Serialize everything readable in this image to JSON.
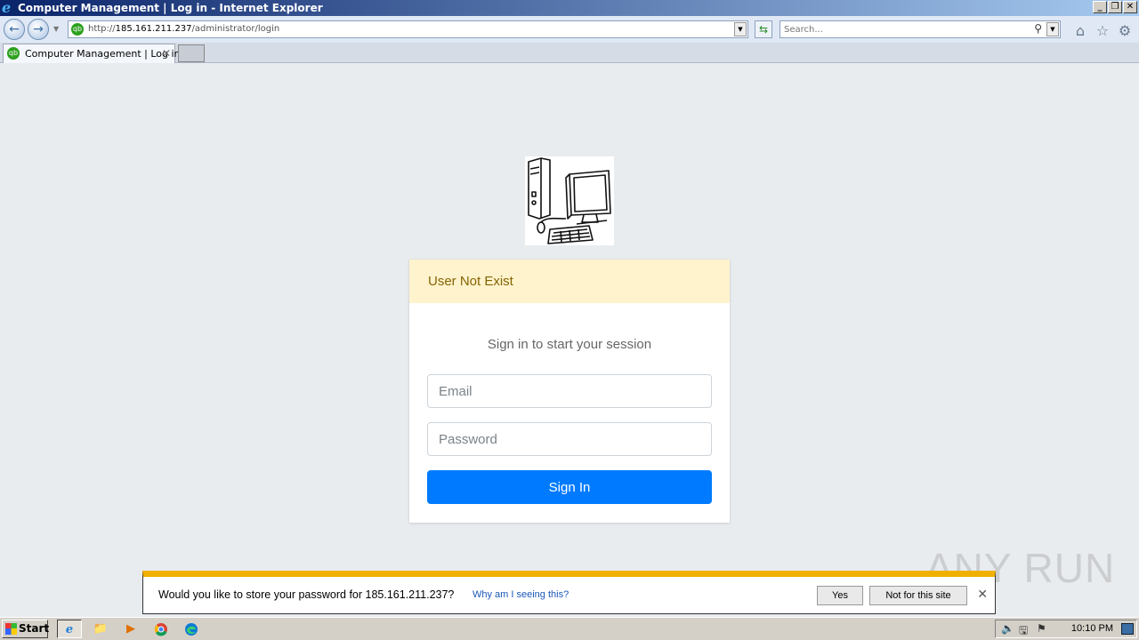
{
  "window": {
    "title": "Computer Management | Log in - Internet Explorer",
    "controls": {
      "minimize": "_",
      "maximize": "❐",
      "close": "✕"
    }
  },
  "addressbar": {
    "url_prefix": "http://",
    "url_host": "185.161.211.237",
    "url_path": "/administrator/login",
    "site_icon": "qb",
    "search_placeholder": "Search..."
  },
  "tabs": [
    {
      "label": "Computer Management | Log in",
      "site_icon": "qb",
      "close": "✕"
    }
  ],
  "login": {
    "alert": "User Not Exist",
    "message": "Sign in to start your session",
    "email_placeholder": "Email",
    "password_placeholder": "Password",
    "submit_label": "Sign In"
  },
  "password_bar": {
    "question": "Would you like to store your password for 185.161.211.237?",
    "why_link": "Why am I seeing this?",
    "yes_label": "Yes",
    "no_label": "Not for this site",
    "close": "✕"
  },
  "watermark": "ANY RUN",
  "taskbar": {
    "start_label": "Start",
    "apps": [
      "ie-icon",
      "folder-icon",
      "media-player-icon",
      "chrome-icon",
      "edge-icon"
    ],
    "clock": "10:10 PM"
  },
  "colors": {
    "alert_bg": "#fff3cd",
    "alert_text": "#856404",
    "primary": "#007bff",
    "warning_bar": "#f0b000"
  }
}
